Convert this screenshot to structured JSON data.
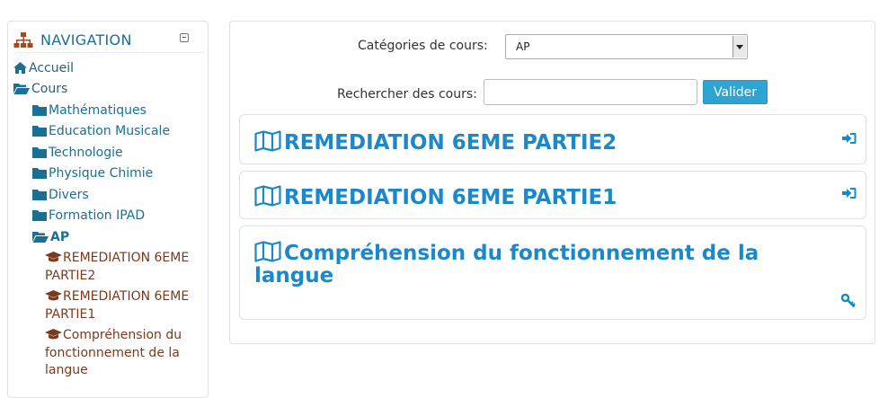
{
  "navigation": {
    "title": "NAVIGATION",
    "home": "Accueil",
    "courses": "Cours",
    "categories": [
      "Mathématiques",
      "Education Musicale",
      "Technologie",
      "Physique Chimie",
      "Divers",
      "Formation IPAD"
    ],
    "current_category": "AP",
    "current_courses": [
      "REMEDIATION 6EME PARTIE2",
      "REMEDIATION 6EME PARTIE1",
      "Compréhension du fonctionnement de la langue"
    ]
  },
  "filter": {
    "category_label": "Catégories de cours:",
    "category_value": "AP",
    "search_label": "Rechercher des cours:",
    "search_value": "",
    "search_button": "Valider"
  },
  "courses": [
    {
      "title": "REMEDIATION 6EME PARTIE2",
      "action_icon": "enrol-icon"
    },
    {
      "title": "REMEDIATION 6EME PARTIE1",
      "action_icon": "enrol-icon"
    },
    {
      "title": "Compréhension du fonctionnement de la langue",
      "action_icon": "key-icon"
    }
  ],
  "colors": {
    "link": "#1b6f93",
    "course_link": "#7b3a1d",
    "title": "#1a88c9",
    "button": "#2fa4d2",
    "nav_icon": "#9a4b28"
  }
}
